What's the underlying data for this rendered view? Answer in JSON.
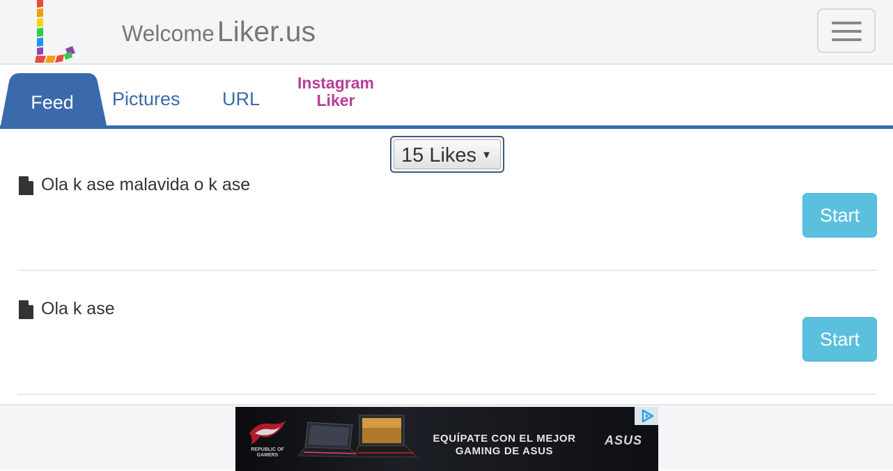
{
  "header": {
    "welcome_label": "Welcome",
    "brand": "Liker.us",
    "menu_icon": "hamburger-icon"
  },
  "tabs": [
    {
      "label": "Feed",
      "active": true
    },
    {
      "label": "Pictures",
      "active": false
    },
    {
      "label": "URL",
      "active": false
    },
    {
      "label": "Instagram Liker",
      "active": false
    }
  ],
  "likes_select": {
    "value": "15 Likes"
  },
  "posts": [
    {
      "text": "Ola k ase malavida o k ase",
      "icon": "document-icon",
      "button": "Start"
    },
    {
      "text": "Ola k ase",
      "icon": "document-icon",
      "button": "Start"
    }
  ],
  "ad": {
    "headline": "EQUÍPATE CON EL MEJOR GAMING DE ASUS",
    "brand": "ASUS",
    "rog_label": "REPUBLIC OF GAMERS"
  },
  "colors": {
    "primary_tab": "#3a6aab",
    "instagram_tab": "#b83c96",
    "start_button": "#5bc0de",
    "navbar_bg": "#f5f5f7"
  }
}
